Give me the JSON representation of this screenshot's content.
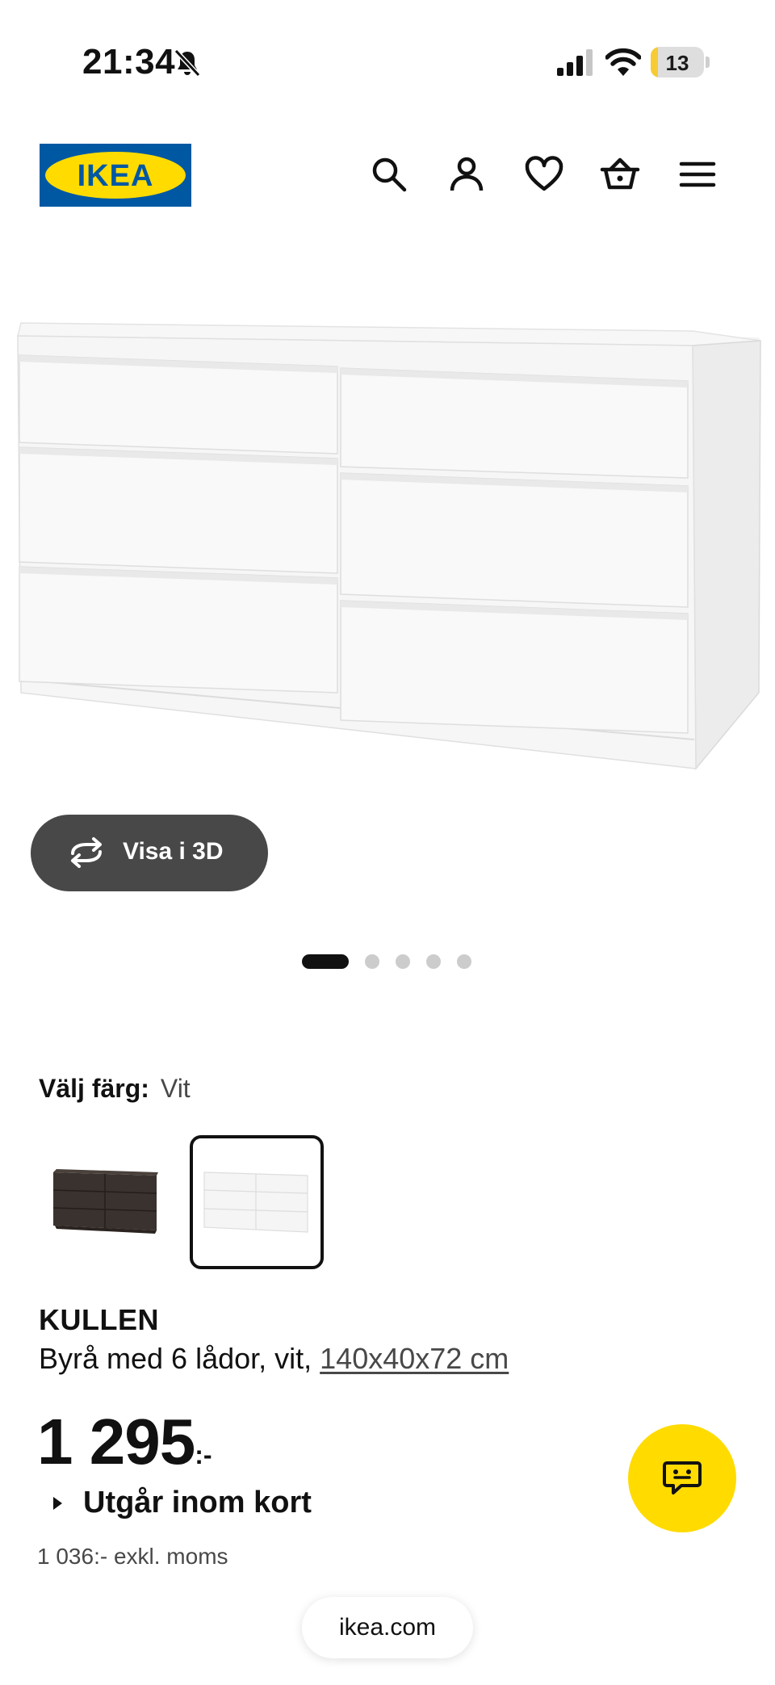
{
  "status_bar": {
    "time": "21:34",
    "battery_level": 13,
    "battery_text": "13",
    "icons": [
      "bell-slash-icon",
      "signal-icon",
      "wifi-icon",
      "battery-icon"
    ]
  },
  "header": {
    "logo_text": "IKEA",
    "icons": [
      "search-icon",
      "account-icon",
      "heart-icon",
      "basket-icon",
      "menu-icon"
    ],
    "colors": {
      "logo_blue": "#0058a3",
      "logo_yellow": "#ffdb00"
    }
  },
  "gallery": {
    "view_3d_label": "Visa i 3D",
    "slide_count": 5,
    "active_slide": 1
  },
  "color_selector": {
    "label": "Välj färg:",
    "selected_value": "Vit",
    "swatches": [
      "Svartbrun",
      "Vit"
    ],
    "selected_index": 1
  },
  "product": {
    "name": "KULLEN",
    "description": "Byrå med 6 lådor, vit, ",
    "dimensions": "140x40x72 cm",
    "price": "1 295",
    "price_suffix": ":-",
    "availability": "Utgår inom kort",
    "price_ex_vat": "1 036:- exkl. moms"
  },
  "chat": {
    "icon": "chat-icon",
    "color": "#ffdb00"
  },
  "browser": {
    "url": "ikea.com"
  }
}
